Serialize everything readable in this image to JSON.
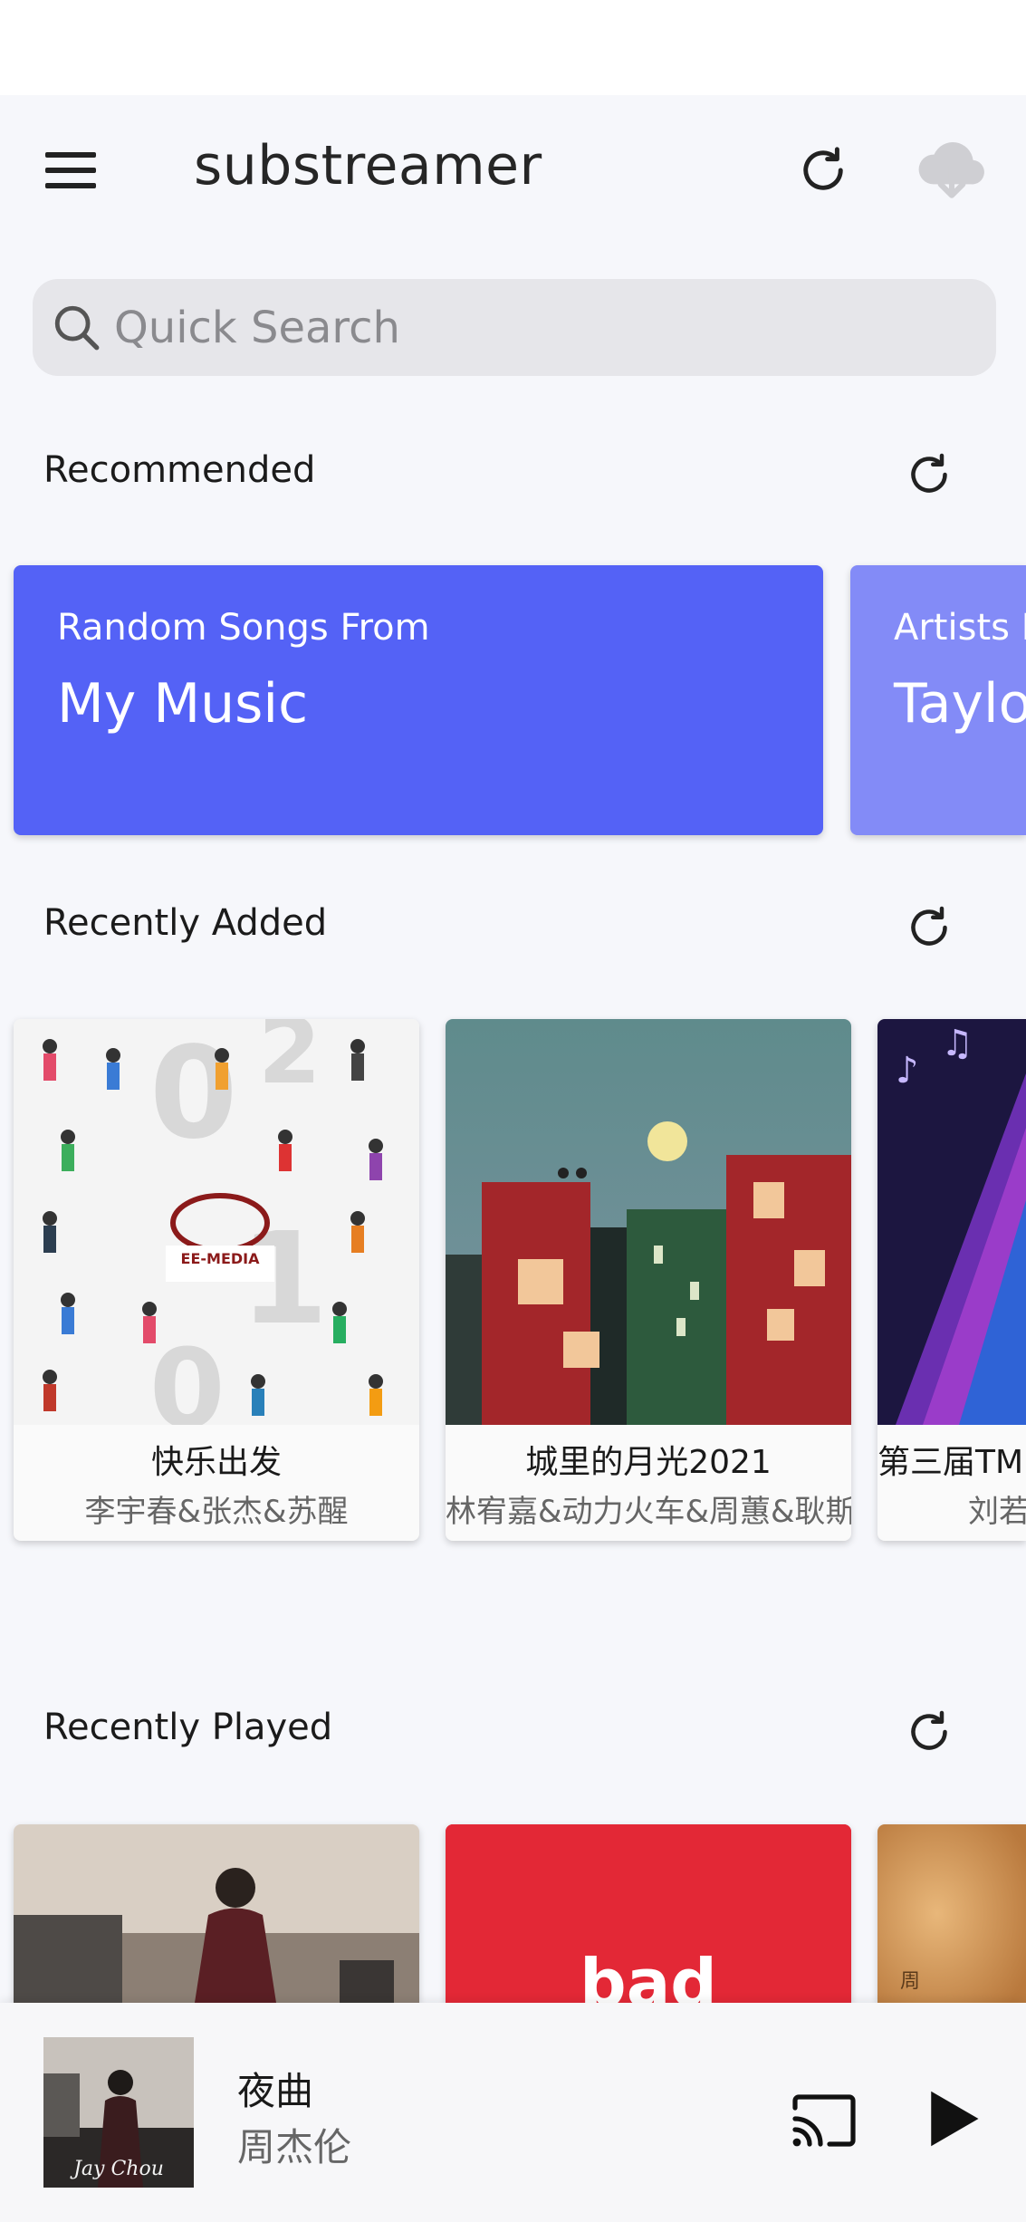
{
  "app": {
    "title": "substreamer",
    "menu_icon": "hamburger-menu-icon",
    "sync_icon": "sync-refresh-icon",
    "cloud_icon": "cloud-download-icon"
  },
  "search": {
    "placeholder": "Quick Search",
    "icon": "search-icon"
  },
  "sections": {
    "recommended": {
      "title": "Recommended",
      "cards": [
        {
          "subtitle": "Random Songs From",
          "title": "My Music",
          "color": "#5462f6"
        },
        {
          "subtitle": "Artists L",
          "title": "Taylo",
          "color": "#838bf7"
        }
      ]
    },
    "recently_added": {
      "title": "Recently Added",
      "albums": [
        {
          "name": "快乐出发",
          "artist": "李宇春&张杰&苏醒"
        },
        {
          "name": "城里的月光2021",
          "artist": "林宥嘉&动力火车&周蕙&耿斯"
        },
        {
          "name": "第三届TMI",
          "artist": "刘若"
        }
      ]
    },
    "recently_played": {
      "title": "Recently Played",
      "tiles": [
        {
          "color": "#c9b8a6"
        },
        {
          "color": "#e32836",
          "text": "bad"
        },
        {
          "color": "#cf9a5c",
          "text": "周"
        }
      ]
    }
  },
  "now_playing": {
    "title": "夜曲",
    "artist": "周杰伦",
    "cast_icon": "cast-icon",
    "play_icon": "play-icon"
  },
  "colors": {
    "background": "#f6f7fb",
    "accent": "#5462f6"
  }
}
